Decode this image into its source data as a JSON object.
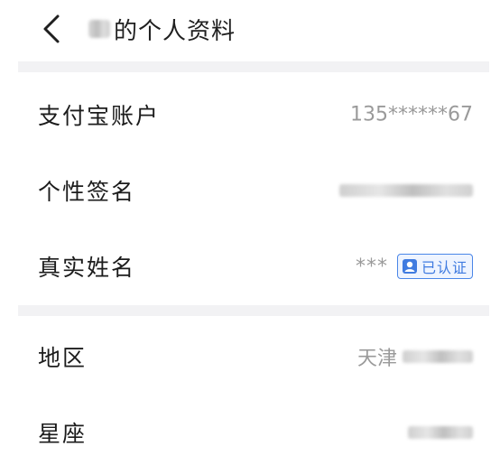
{
  "header": {
    "title_suffix": "的个人资料"
  },
  "rows": [
    {
      "label": "支付宝账户",
      "value": "135******67"
    },
    {
      "label": "个性签名"
    },
    {
      "label": "真实姓名",
      "value": "***",
      "badge": "已认证"
    },
    {
      "label": "地区",
      "value": "天津"
    },
    {
      "label": "星座"
    }
  ],
  "colors": {
    "divider": "#f2f2f4",
    "badge_blue": "#4a86e8",
    "value_gray": "#9a9a9a"
  },
  "icons": {
    "back": "chevron-left-icon",
    "verified": "verified-person-icon"
  }
}
